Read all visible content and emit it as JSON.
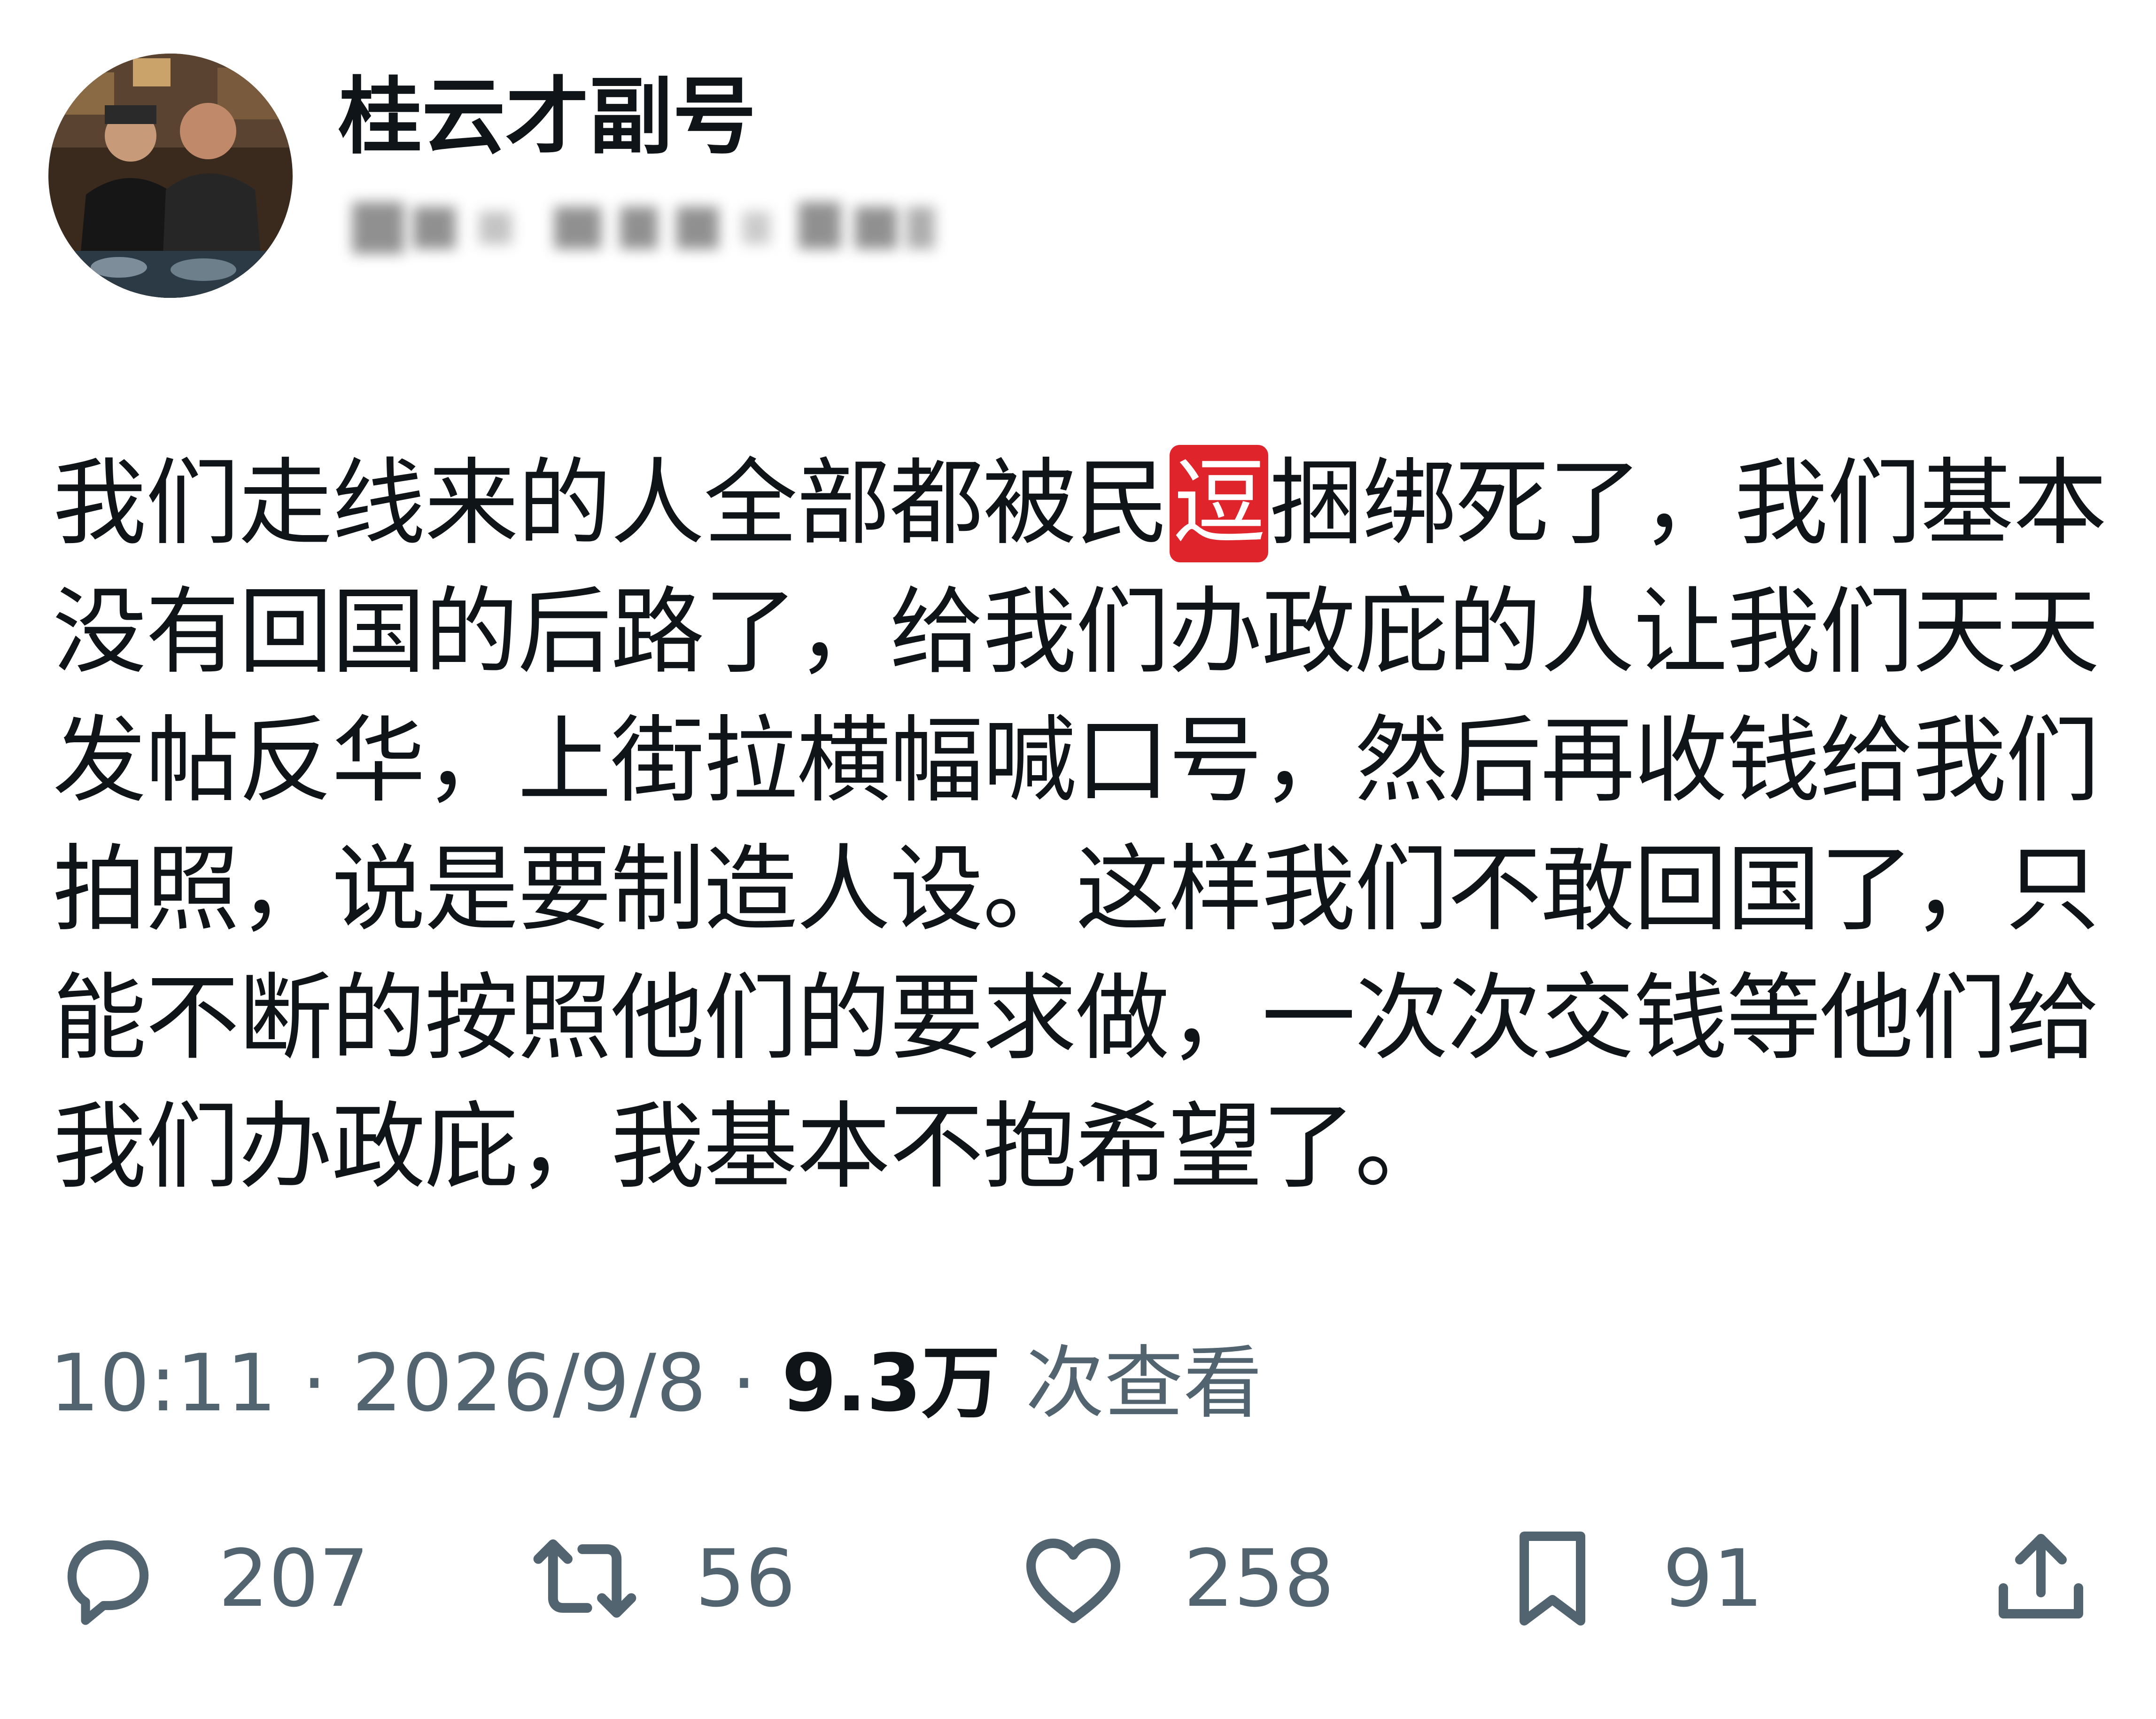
{
  "author": {
    "display_name": "桂云才副号"
  },
  "post": {
    "text_before": "我们走线来的人全部都被民",
    "censored_char": "逗",
    "text_after": "捆绑死了，我们基本没有回国的后路了，给我们办政庇的人让我们天天发帖反华，上街拉横幅喊口号，然后再收钱给我们拍照，说是要制造人设。这样我们不敢回国了，只能不断的按照他们的要求做，一次次交钱等他们给我们办政庇，我基本不抱希望了。"
  },
  "meta": {
    "time": "10:11",
    "sep1": " · ",
    "date": "2026/9/8",
    "sep2": " · ",
    "views_count": "9.3万",
    "views_label": " 次查看"
  },
  "actions": {
    "replies": "207",
    "reposts": "56",
    "likes": "258",
    "bookmarks": "91"
  },
  "colors": {
    "text": "#0f1419",
    "secondary": "#536471",
    "censor_highlight": "#e0242c"
  },
  "icons": [
    "reply-icon",
    "repost-icon",
    "like-icon",
    "bookmark-icon",
    "share-icon"
  ]
}
